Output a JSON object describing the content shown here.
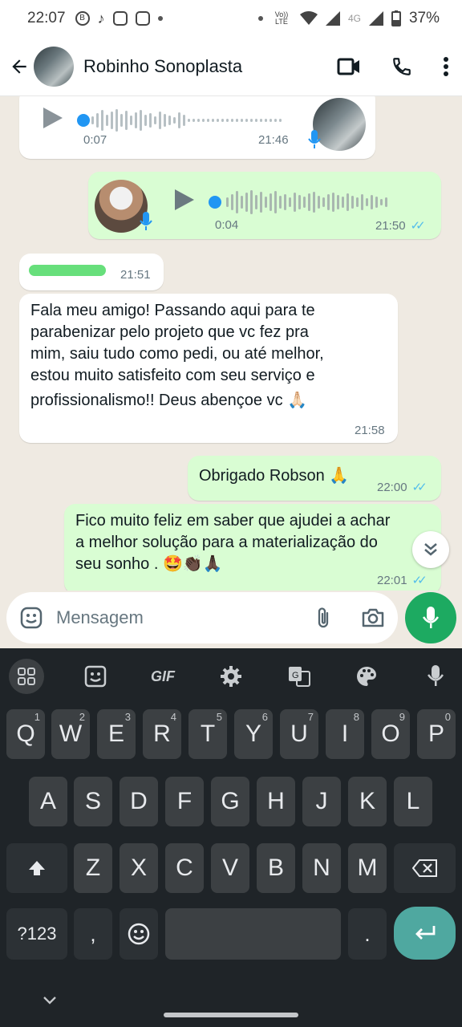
{
  "status_bar": {
    "time": "22:07",
    "network": "Vo)) LTE",
    "network_type": "4G",
    "battery": "37%"
  },
  "header": {
    "contact_name": "Robinho Sonoplasta"
  },
  "messages": [
    {
      "id": "voice-1",
      "direction": "in",
      "duration": "0:07",
      "time": "21:46"
    },
    {
      "id": "voice-2",
      "direction": "out",
      "duration": "0:04",
      "time": "21:50"
    },
    {
      "id": "redacted-1",
      "direction": "in",
      "time": "21:51"
    },
    {
      "id": "text-1",
      "direction": "in",
      "lines": [
        "Fala meu amigo! Passando aqui para te",
        "parabenizar pelo projeto que vc fez pra",
        "mim, saiu tudo como pedi, ou até melhor,",
        "estou muito satisfeito com seu serviço e",
        "profissionalismo!! Deus abençoe vc 🙏🏻"
      ],
      "time": "21:58"
    },
    {
      "id": "text-2",
      "direction": "out",
      "text": "Obrigado Robson 🙏",
      "time": "22:00"
    },
    {
      "id": "text-3",
      "direction": "out",
      "lines": [
        "Fico muito feliz em saber que ajudei a achar",
        "a melhor solução para a materialização do",
        "seu sonho . 🤩👏🏿🙏🏿"
      ],
      "time": "22:01"
    }
  ],
  "composer": {
    "placeholder": "Mensagem"
  },
  "keyboard": {
    "toolbar": [
      "grid-icon",
      "sticker-icon",
      "GIF",
      "settings-icon",
      "translate-icon",
      "palette-icon",
      "mic-icon"
    ],
    "row1": [
      [
        "Q",
        "1"
      ],
      [
        "W",
        "2"
      ],
      [
        "E",
        "3"
      ],
      [
        "R",
        "4"
      ],
      [
        "T",
        "5"
      ],
      [
        "Y",
        "6"
      ],
      [
        "U",
        "7"
      ],
      [
        "I",
        "8"
      ],
      [
        "O",
        "9"
      ],
      [
        "P",
        "0"
      ]
    ],
    "row2": [
      "A",
      "S",
      "D",
      "F",
      "G",
      "H",
      "J",
      "K",
      "L"
    ],
    "row3": [
      "Z",
      "X",
      "C",
      "V",
      "B",
      "N",
      "M"
    ],
    "symbols_label": "?123",
    "comma": ",",
    "period": "."
  },
  "colors": {
    "accent": "#1daa61",
    "bubble_out": "#d9fdd3",
    "bubble_in": "#ffffff",
    "chat_bg": "#efeae2",
    "keyboard_bg": "#1f2428",
    "read_ticks": "#53bdeb"
  }
}
